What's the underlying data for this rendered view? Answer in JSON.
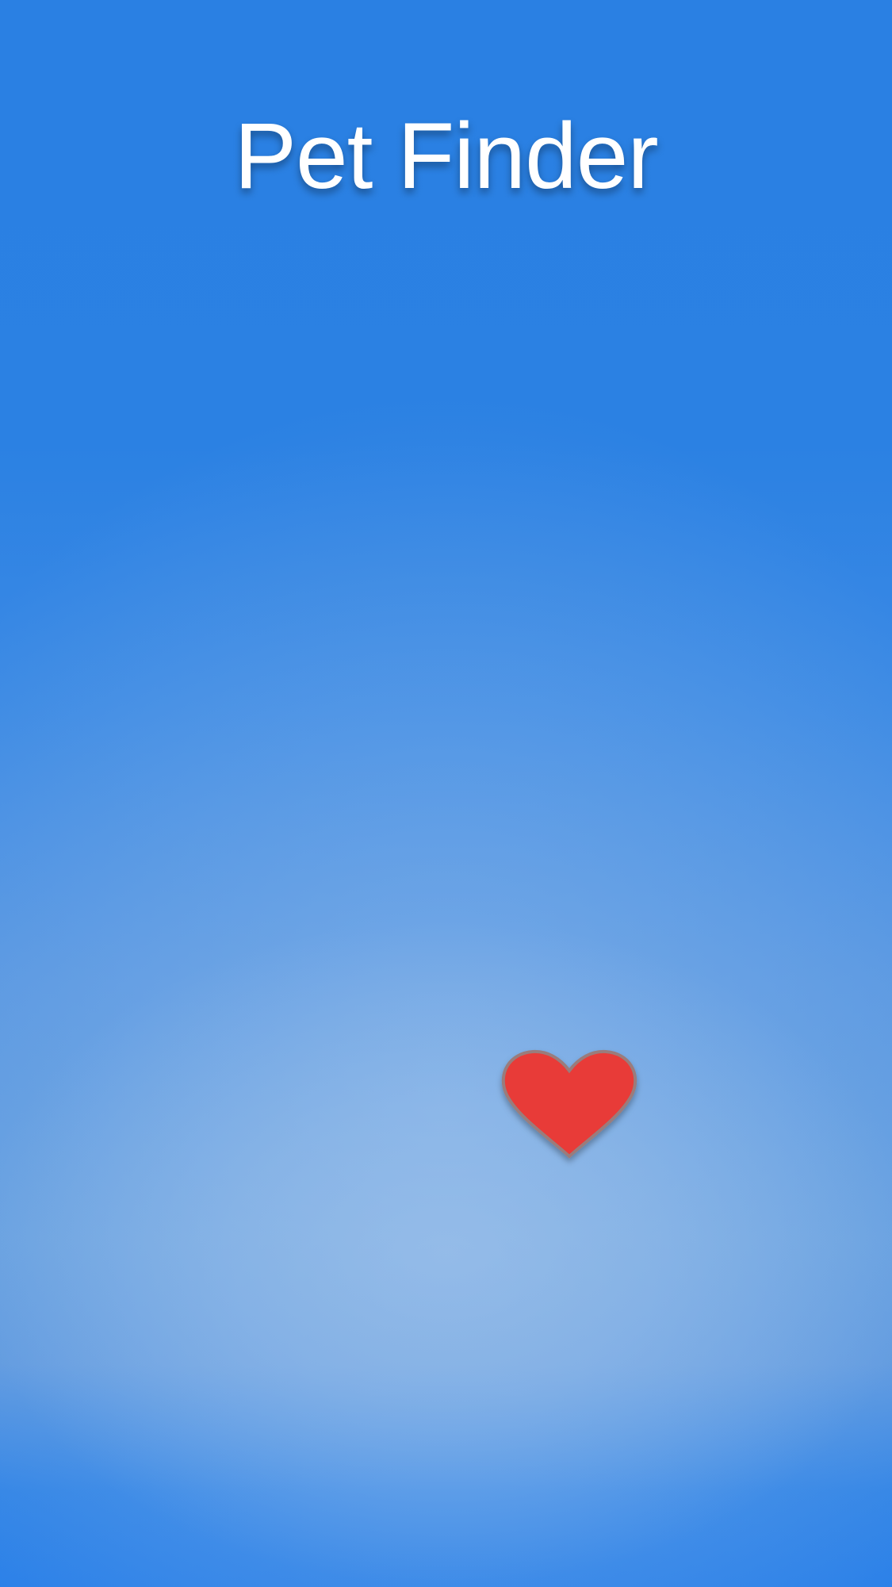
{
  "header": {
    "title": "Pet Finder"
  },
  "favorite": {
    "icon": "heart-icon",
    "color": "#e83a37",
    "outline_color": "#9a7b7b"
  },
  "colors": {
    "background_top": "#2a80e3",
    "background_mid": "#629ddf",
    "title_text": "#ffffff"
  }
}
